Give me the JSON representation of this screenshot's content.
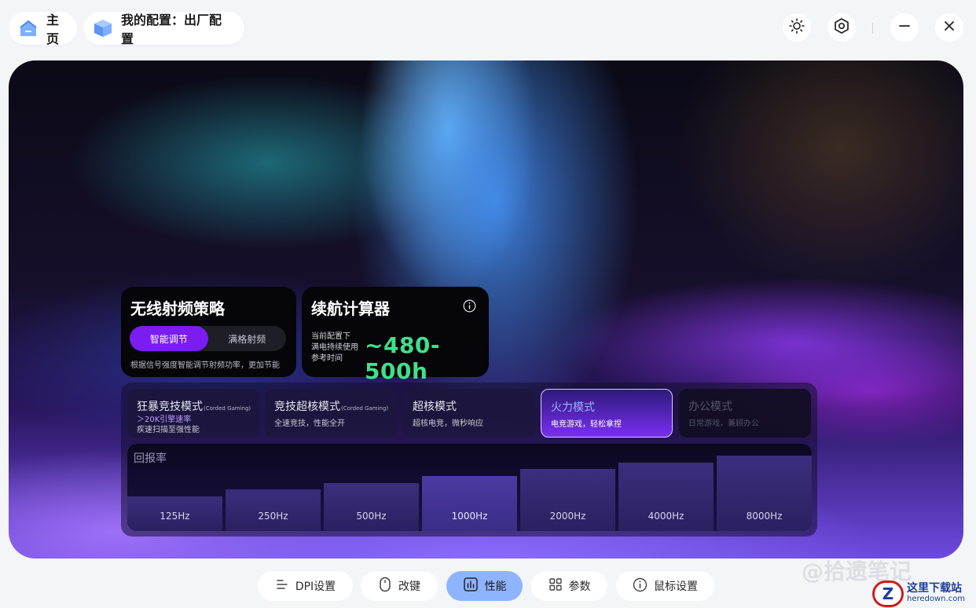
{
  "header": {
    "home_label": "主页",
    "config_label": "我的配置：出厂配置",
    "icons": [
      "home-icon",
      "cube-icon",
      "brightness-icon",
      "settings-icon",
      "minimize-icon",
      "close-icon"
    ]
  },
  "rf_card": {
    "title": "无线射频策略",
    "options": [
      "智能调节",
      "满格射频"
    ],
    "selected": "智能调节",
    "description": "根据信号强度智能调节射频功率，更加节能"
  },
  "battery_card": {
    "title": "续航计算器",
    "label_lines": [
      "当前配置下",
      "满电持续使用",
      "参考时间"
    ],
    "value": "~480-500h",
    "value_color": "#3fe08a"
  },
  "modes": [
    {
      "title": "狂暴竞技模式",
      "tag": "(Corded Gaming)",
      "sub_hl": "＞20K引擎速率",
      "sub": "疾速扫描至强性能",
      "state": "normal"
    },
    {
      "title": "竞技超核模式",
      "tag": "(Corded Gaming)",
      "sub_hl": "",
      "sub": "全速竞技，性能全开",
      "state": "normal"
    },
    {
      "title": "超核模式",
      "tag": "",
      "sub_hl": "",
      "sub": "超核电竞，微秒响应",
      "state": "normal"
    },
    {
      "title": "火力模式",
      "tag": "",
      "sub_hl": "",
      "sub": "电竞游戏，轻松拿捏",
      "state": "active"
    },
    {
      "title": "办公模式",
      "tag": "",
      "sub_hl": "",
      "sub": "日常游戏，兼顾办公",
      "state": "dim"
    }
  ],
  "polling": {
    "title": "回报率",
    "rates": [
      "125Hz",
      "250Hz",
      "500Hz",
      "1000Hz",
      "2000Hz",
      "4000Hz",
      "8000Hz"
    ],
    "selected": "1000Hz"
  },
  "bottom_nav": [
    {
      "label": "DPI设置",
      "icon": "dpi-icon",
      "active": false
    },
    {
      "label": "改键",
      "icon": "mouse-icon",
      "active": false
    },
    {
      "label": "性能",
      "icon": "performance-icon",
      "active": true
    },
    {
      "label": "参数",
      "icon": "grid-icon",
      "active": false
    },
    {
      "label": "鼠标设置",
      "icon": "info-icon",
      "active": false
    }
  ],
  "watermarks": {
    "weibo": "@拾遗笔记",
    "site_name": "这里下载站",
    "site_url": "heredown.com"
  },
  "colors": {
    "accent": "#7a1cf2",
    "active_nav": "#8fb4ff"
  }
}
